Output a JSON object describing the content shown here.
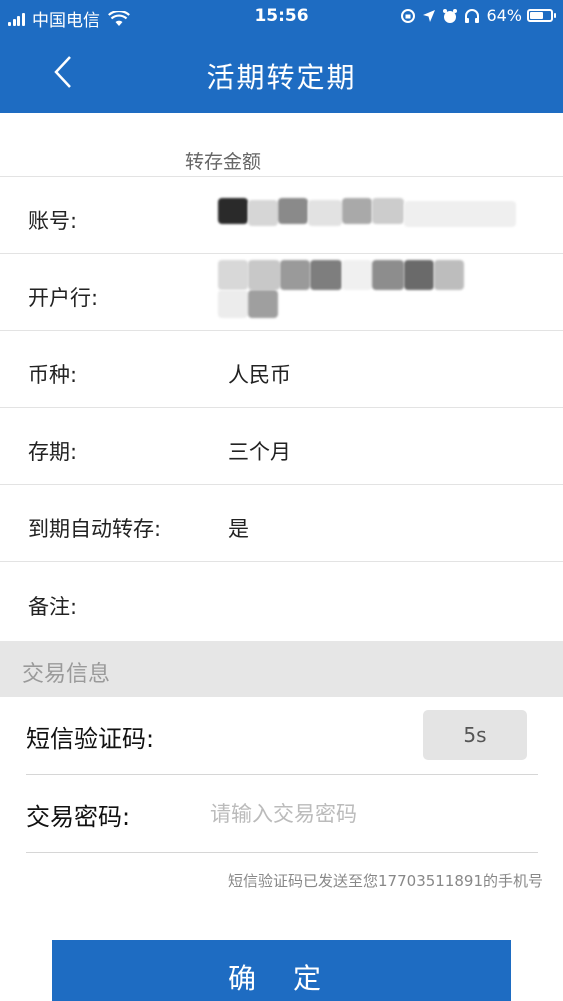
{
  "status_bar": {
    "carrier": "中国电信",
    "time": "15:56",
    "battery_text": "64%",
    "battery_level": 0.64,
    "icons": [
      "signal-icon",
      "wifi-icon",
      "lock-rotation-icon",
      "location-icon",
      "alarm-icon",
      "headphones-icon",
      "battery-icon"
    ]
  },
  "nav": {
    "title": "活期转定期",
    "back_icon": "chevron-left-icon"
  },
  "section_transfer": {
    "heading": "转存金额",
    "rows": [
      {
        "label": "账号:",
        "value": ""
      },
      {
        "label": "开户行:",
        "value": ""
      },
      {
        "label": "币种:",
        "value": "人民币"
      },
      {
        "label": "存期:",
        "value": "三个月"
      },
      {
        "label": "到期自动转存:",
        "value": "是"
      },
      {
        "label": "备注:",
        "value": ""
      }
    ]
  },
  "section_trade": {
    "heading": "交易信息",
    "sms_label": "短信验证码:",
    "sms_button": "5s",
    "password_label": "交易密码:",
    "password_placeholder": "请输入交易密码",
    "hint": "短信验证码已发送至您17703511891的手机号"
  },
  "confirm_button": "确 定",
  "colors": {
    "primary": "#1e6cc2",
    "section_bg": "#e6e6e6",
    "divider": "#e3e3e3"
  }
}
